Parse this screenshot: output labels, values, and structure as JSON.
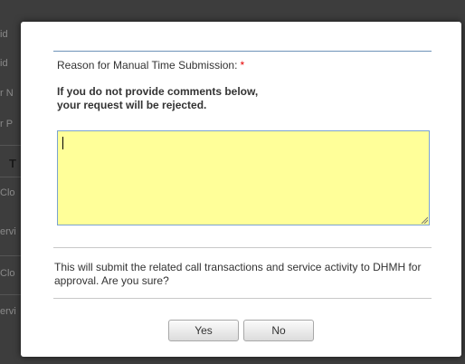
{
  "background": {
    "fragments": [
      "id",
      "id",
      "r N",
      "r P",
      "T",
      "Clo",
      "ervi",
      "Clo",
      "ervi"
    ]
  },
  "dialog": {
    "reason_label": "Reason for Manual Time Submission:",
    "required_marker": "*",
    "warning_line1": "If you do not provide comments below,",
    "warning_line2": "your request will be rejected.",
    "comment_value": "",
    "confirm_text": "This will submit the related call transactions and service activity to DHMH for approval. Are you sure?",
    "yes_label": "Yes",
    "no_label": "No"
  },
  "colors": {
    "comment_background": "#ffff99",
    "required_marker": "#e60000",
    "accent_rule": "#6e93b8"
  }
}
